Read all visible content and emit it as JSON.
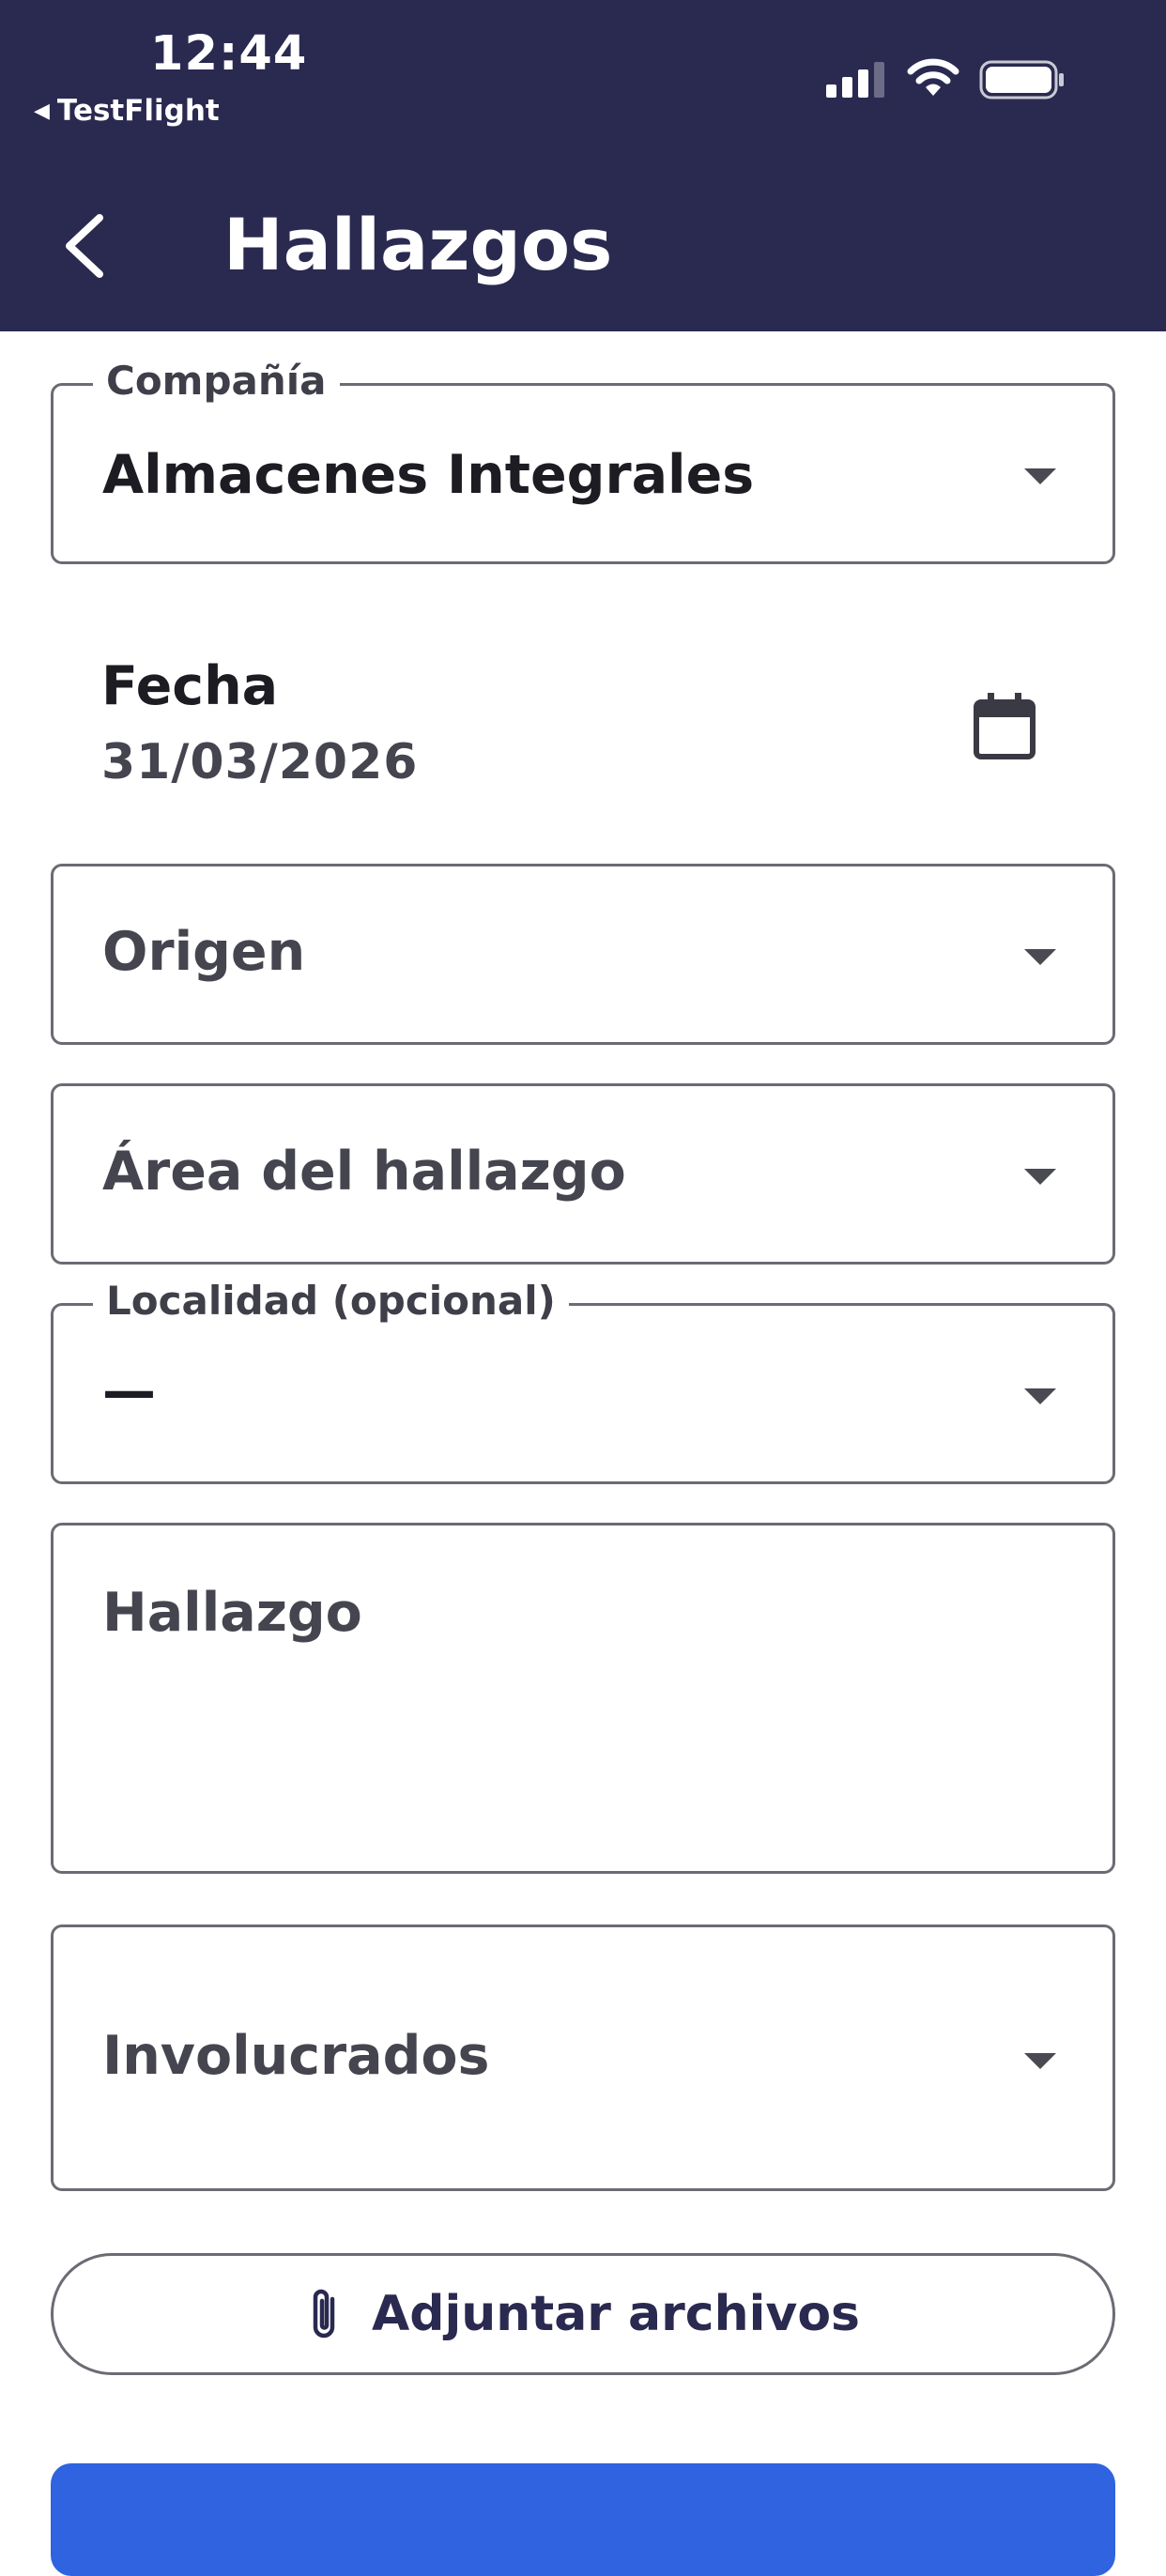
{
  "status_bar": {
    "time": "12:44",
    "back_app": "TestFlight"
  },
  "header": {
    "title": "Hallazgos",
    "back_icon": "chevron-left-icon",
    "color": "#2a2950"
  },
  "form": {
    "company": {
      "label": "Compañía",
      "value": "Almacenes Integrales"
    },
    "date": {
      "label": "Fecha",
      "value": "31/03/2026"
    },
    "origin": {
      "placeholder": "Origen"
    },
    "area": {
      "placeholder": "Área del hallazgo"
    },
    "locality": {
      "label": "Localidad (opcional)",
      "value": "—"
    },
    "finding": {
      "placeholder": "Hallazgo"
    },
    "involved": {
      "placeholder": "Involucrados"
    },
    "attach_label": "Adjuntar archivos"
  },
  "colors": {
    "primary_button": "#2f63e0",
    "border": "#6b6b74"
  }
}
